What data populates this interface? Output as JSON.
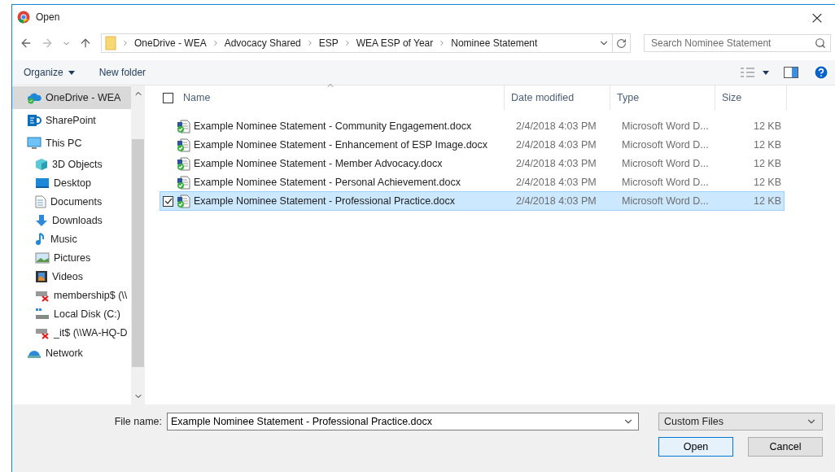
{
  "window": {
    "title": "Open",
    "close": "×"
  },
  "address_bar": {
    "path": [
      "OneDrive - WEA",
      "Advocacy Shared",
      "ESP",
      "WEA ESP of Year",
      "Nominee Statement"
    ]
  },
  "search": {
    "placeholder": "Search Nominee Statement"
  },
  "toolbar": {
    "organize": "Organize",
    "new_folder": "New folder"
  },
  "sidebar": {
    "items": [
      {
        "label": "OneDrive - WEA",
        "selected": true
      },
      {
        "label": "SharePoint",
        "selected": false
      },
      {
        "label": "This PC",
        "selected": false,
        "children": [
          {
            "label": "3D Objects",
            "selected": false
          },
          {
            "label": "Desktop",
            "selected": false
          },
          {
            "label": "Documents",
            "selected": false
          },
          {
            "label": "Downloads",
            "selected": false
          },
          {
            "label": "Music",
            "selected": false
          },
          {
            "label": "Pictures",
            "selected": false
          },
          {
            "label": "Videos",
            "selected": false
          },
          {
            "label": "membership$ (\\\\",
            "selected": false
          },
          {
            "label": "Local Disk (C:)",
            "selected": false
          },
          {
            "label": "_it$ (\\\\WA-HQ-D",
            "selected": false
          }
        ]
      },
      {
        "label": "Network",
        "selected": false
      }
    ]
  },
  "table": {
    "columns": [
      "Name",
      "Date modified",
      "Type",
      "Size"
    ],
    "select_all_checked": false,
    "rows": [
      {
        "name": "Example Nominee Statement - Community Engagement.docx",
        "date": "2/4/2018 4:03 PM",
        "type": "Microsoft Word D...",
        "size": "12 KB",
        "selected": false
      },
      {
        "name": "Example Nominee Statement - Enhancement of ESP Image.docx",
        "date": "2/4/2018 4:03 PM",
        "type": "Microsoft Word D...",
        "size": "12 KB",
        "selected": false
      },
      {
        "name": "Example Nominee Statement - Member Advocacy.docx",
        "date": "2/4/2018 4:03 PM",
        "type": "Microsoft Word D...",
        "size": "12 KB",
        "selected": false
      },
      {
        "name": "Example Nominee Statement - Personal Achievement.docx",
        "date": "2/4/2018 4:03 PM",
        "type": "Microsoft Word D...",
        "size": "12 KB",
        "selected": false
      },
      {
        "name": "Example Nominee Statement - Professional Practice.docx",
        "date": "2/4/2018 4:03 PM",
        "type": "Microsoft Word D...",
        "size": "12 KB",
        "selected": true
      }
    ]
  },
  "footer": {
    "file_name_label": "File name:",
    "file_name": "Example Nominee Statement - Professional Practice.docx",
    "file_type": "Custom Files",
    "buttons": [
      "Open",
      "Cancel"
    ]
  }
}
